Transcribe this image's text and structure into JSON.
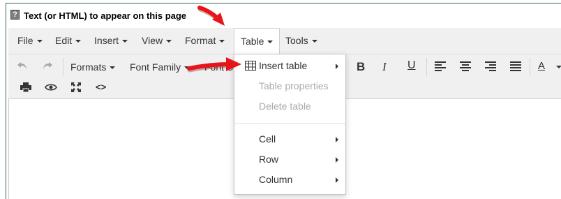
{
  "header": {
    "help_icon": "?",
    "label": "Text (or HTML) to appear on this page"
  },
  "menubar": {
    "items": [
      {
        "label": "File"
      },
      {
        "label": "Edit"
      },
      {
        "label": "Insert"
      },
      {
        "label": "View"
      },
      {
        "label": "Format"
      },
      {
        "label": "Table"
      },
      {
        "label": "Tools"
      }
    ]
  },
  "toolbar": {
    "formats": "Formats",
    "font_family": "Font Family",
    "font_size_partial": "Font S",
    "icons": [
      "undo-icon",
      "redo-icon",
      "bold-icon",
      "italic-icon",
      "underline-icon",
      "align-left-icon",
      "align-center-icon",
      "align-right-icon",
      "align-justify-icon",
      "text-color-icon",
      "print-icon",
      "preview-icon",
      "fullscreen-icon",
      "source-code-icon"
    ],
    "bold": "B",
    "italic": "I",
    "underline": "U",
    "text_color": "A",
    "source_code": "<>"
  },
  "table_menu": {
    "items": [
      {
        "label": "Insert table",
        "enabled": true,
        "submenu": true
      },
      {
        "label": "Table properties",
        "enabled": false,
        "submenu": false
      },
      {
        "label": "Delete table",
        "enabled": false,
        "submenu": false
      },
      {
        "label": "Cell",
        "enabled": true,
        "submenu": true
      },
      {
        "label": "Row",
        "enabled": true,
        "submenu": true
      },
      {
        "label": "Column",
        "enabled": true,
        "submenu": true
      }
    ]
  },
  "colors": {
    "arrow": "#e8141a",
    "border": "#2f6b57",
    "toolbar_bg": "#f0f0f0"
  }
}
